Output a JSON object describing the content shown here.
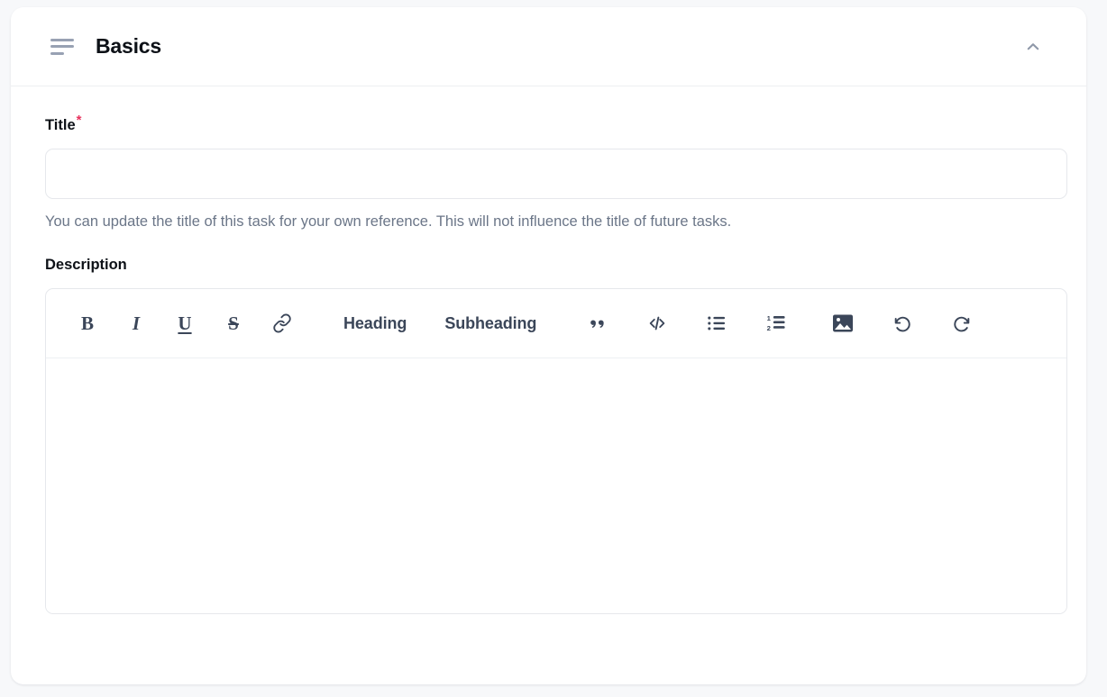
{
  "card": {
    "header": {
      "title": "Basics",
      "menu_icon": "list-lines-icon",
      "collapse_icon": "chevron-up-icon"
    }
  },
  "fields": {
    "title": {
      "label": "Title",
      "required_marker": "*",
      "value": "",
      "placeholder": "",
      "helper": "You can update the title of this task for your own reference. This will not influence the title of future tasks."
    },
    "description": {
      "label": "Description",
      "value": "",
      "placeholder": ""
    }
  },
  "editor_toolbar": {
    "bold": {
      "label": "B",
      "name": "bold-icon"
    },
    "italic": {
      "label": "I",
      "name": "italic-icon"
    },
    "underline": {
      "label": "U",
      "name": "underline-icon"
    },
    "strikethrough": {
      "label": "S",
      "name": "strikethrough-icon"
    },
    "link": {
      "name": "link-icon"
    },
    "heading": {
      "label": "Heading"
    },
    "subheading": {
      "label": "Subheading"
    },
    "blockquote": {
      "name": "quote-icon"
    },
    "code": {
      "label": "</>",
      "name": "code-icon"
    },
    "bullet_list": {
      "name": "bullet-list-icon"
    },
    "numbered_list": {
      "name": "numbered-list-icon",
      "first": "1",
      "second": "2"
    },
    "image": {
      "name": "image-icon"
    },
    "undo": {
      "name": "undo-icon"
    },
    "redo": {
      "name": "redo-icon"
    }
  },
  "colors": {
    "page_background": "#f7f8fa",
    "card_background": "#ffffff",
    "required_asterisk": "#e8335e",
    "icon": "#3b4659",
    "muted_icon": "#98a1b3",
    "helper_text": "#6b7688",
    "border": "#e6e8ec"
  }
}
